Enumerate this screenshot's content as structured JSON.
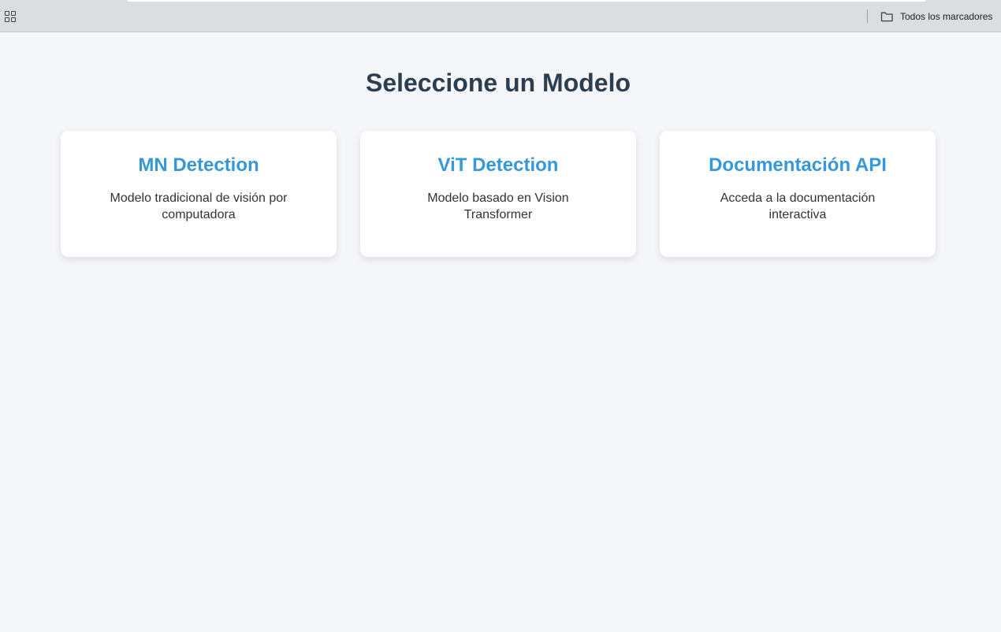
{
  "browser": {
    "bookmarks_folder_label": "Todos los marcadores",
    "icons": {
      "apps": "apps-grid-icon",
      "folder": "folder-icon"
    }
  },
  "page": {
    "title": "Seleccione un Modelo",
    "cards": [
      {
        "title": "MN Detection",
        "description": "Modelo tradicional de visión por computadora"
      },
      {
        "title": "ViT Detection",
        "description": "Modelo basado en Vision Transformer"
      },
      {
        "title": "Documentación API",
        "description": "Acceda a la documentación interactiva"
      }
    ]
  },
  "colors": {
    "accent": "#3498db",
    "title": "#2c3e50",
    "background": "#f5f6fa",
    "card": "#ffffff",
    "text": "#333333"
  }
}
